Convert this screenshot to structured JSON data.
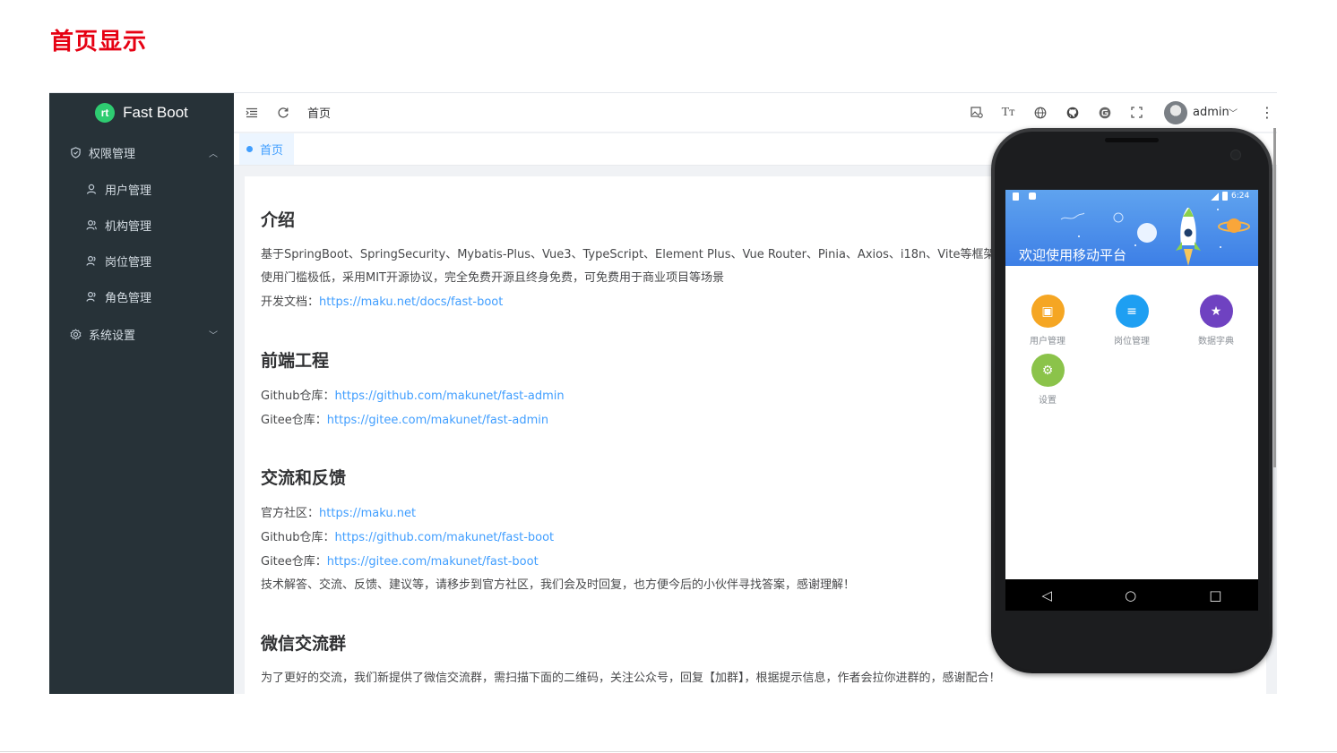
{
  "page_title": "首页显示",
  "app": {
    "logo_mark": "rt",
    "logo_text": "Fast Boot",
    "sidebar": {
      "group1_label": "权限管理",
      "items": [
        {
          "label": "用户管理",
          "icon": "user-icon"
        },
        {
          "label": "机构管理",
          "icon": "org-icon"
        },
        {
          "label": "岗位管理",
          "icon": "post-icon"
        },
        {
          "label": "角色管理",
          "icon": "role-icon"
        }
      ],
      "group2_label": "系统设置"
    },
    "topbar": {
      "breadcrumb": "首页",
      "user": "admin"
    },
    "tab": {
      "label": "首页"
    }
  },
  "content": {
    "intro_title": "介绍",
    "intro_line1": "基于SpringBoot、SpringSecurity、Mybatis-Plus、Vue3、TypeScript、Element Plus、Vue Router、Pinia、Axios、i18n、Vite等框架，开发",
    "intro_line2": "使用门槛极低，采用MIT开源协议，完全免费开源且终身免费，可免费用于商业项目等场景",
    "docs_label": "开发文档：",
    "docs_link": "https://maku.net/docs/fast-boot",
    "frontend_title": "前端工程",
    "fe_github_label": "Github仓库：",
    "fe_github_link": "https://github.com/makunet/fast-admin",
    "fe_gitee_label": "Gitee仓库：",
    "fe_gitee_link": "https://gitee.com/makunet/fast-admin",
    "feedback_title": "交流和反馈",
    "community_label": "官方社区：",
    "community_link": "https://maku.net",
    "fb_github_label": "Github仓库：",
    "fb_github_link": "https://github.com/makunet/fast-boot",
    "fb_gitee_label": "Gitee仓库：",
    "fb_gitee_link": "https://gitee.com/makunet/fast-boot",
    "feedback_note": "技术解答、交流、反馈、建议等，请移步到官方社区，我们会及时回复，也方便今后的小伙伴寻找答案，感谢理解！",
    "wechat_title": "微信交流群",
    "wechat_note": "为了更好的交流，我们新提供了微信交流群，需扫描下面的二维码，关注公众号，回复【加群】，根据提示信息，作者会拉你进群的，感谢配合！"
  },
  "phone": {
    "time": "6:24",
    "title": "欢迎使用移动平台",
    "grid": [
      {
        "label": "用户管理",
        "color": "#f5a623",
        "icon": "user-card-icon",
        "glyph": "▣"
      },
      {
        "label": "岗位管理",
        "color": "#1e9ff2",
        "icon": "list-icon",
        "glyph": "≡"
      },
      {
        "label": "数据字典",
        "color": "#6f42c1",
        "icon": "star-icon",
        "glyph": "★"
      },
      {
        "label": "设置",
        "color": "#8bc34a",
        "icon": "gear-icon",
        "glyph": "⚙"
      }
    ]
  }
}
